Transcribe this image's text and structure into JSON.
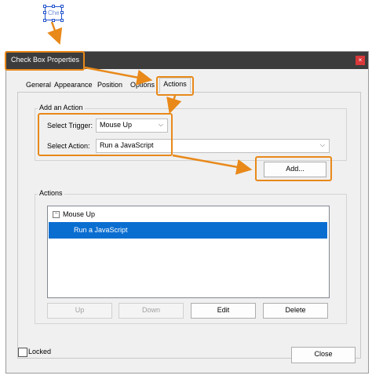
{
  "widget": {
    "label": "Che"
  },
  "dialog": {
    "title": "Check Box Properties",
    "close_glyph": "×",
    "tabs": [
      "General",
      "Appearance",
      "Position",
      "Options",
      "Actions"
    ],
    "active_tab": "Actions",
    "add_action": {
      "legend": "Add an Action",
      "trigger_label": "Select Trigger:",
      "trigger_value": "Mouse Up",
      "action_label": "Select Action:",
      "action_value": "Run a JavaScript",
      "add_button": "Add..."
    },
    "actions": {
      "legend": "Actions",
      "tree": {
        "expander": "−",
        "node": "Mouse Up",
        "child": "Run a JavaScript"
      },
      "buttons": {
        "up": "Up",
        "down": "Down",
        "edit": "Edit",
        "delete": "Delete"
      }
    },
    "locked_label": "Locked",
    "close_button": "Close"
  },
  "colors": {
    "highlight": "#e8891a",
    "selection": "#0a6ed1",
    "titlebar": "#3c3c3c"
  },
  "icons": {
    "dropdown": "chevron-down-icon"
  }
}
